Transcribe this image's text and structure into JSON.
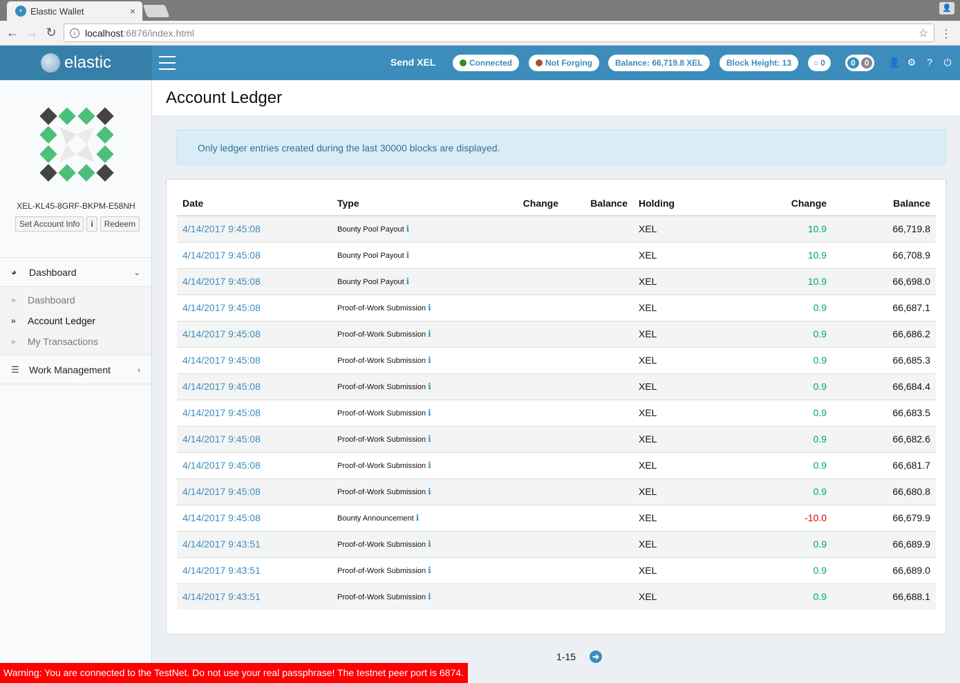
{
  "browser": {
    "tab_title": "Elastic Wallet",
    "tab_close": "×",
    "url_host": "localhost",
    "url_path": ":6876/index.html"
  },
  "header": {
    "logo_text": "elastic",
    "send_label": "Send XEL",
    "connected_label": "Connected",
    "forging_label": "Not Forging",
    "balance_label": "Balance: 66,719.8 XEL",
    "block_height_label": "Block Height: 13",
    "pending_count": "0",
    "msg_count_a": "0",
    "msg_count_b": "0",
    "colors": {
      "bar": "#3c8dbc",
      "logo_bg": "#367fa9",
      "connected_dot": "#00a65a",
      "forging_dot": "#a0522d"
    }
  },
  "sidebar": {
    "account_id": "XEL-KL45-8GRF-BKPM-E58NH",
    "set_account_info": "Set Account Info",
    "info_btn": "i",
    "redeem": "Redeem",
    "menu": {
      "dashboard_group": "Dashboard",
      "items": [
        "Dashboard",
        "Account Ledger",
        "My Transactions"
      ],
      "active_index": 1,
      "work_group": "Work Management"
    }
  },
  "main": {
    "title": "Account Ledger",
    "alert": "Only ledger entries created during the last 30000 blocks are displayed.",
    "columns": [
      "Date",
      "Type",
      "Change",
      "Balance",
      "Holding",
      "Change",
      "Balance"
    ],
    "rows": [
      {
        "date": "4/14/2017 9:45:08",
        "type": "Bounty Pool Payout",
        "holding": "XEL",
        "change": "10.9",
        "balance": "66,719.8",
        "sign": "pos"
      },
      {
        "date": "4/14/2017 9:45:08",
        "type": "Bounty Pool Payout",
        "holding": "XEL",
        "change": "10.9",
        "balance": "66,708.9",
        "sign": "pos"
      },
      {
        "date": "4/14/2017 9:45:08",
        "type": "Bounty Pool Payout",
        "holding": "XEL",
        "change": "10.9",
        "balance": "66,698.0",
        "sign": "pos"
      },
      {
        "date": "4/14/2017 9:45:08",
        "type": "Proof-of-Work Submission",
        "holding": "XEL",
        "change": "0.9",
        "balance": "66,687.1",
        "sign": "pos"
      },
      {
        "date": "4/14/2017 9:45:08",
        "type": "Proof-of-Work Submission",
        "holding": "XEL",
        "change": "0.9",
        "balance": "66,686.2",
        "sign": "pos"
      },
      {
        "date": "4/14/2017 9:45:08",
        "type": "Proof-of-Work Submission",
        "holding": "XEL",
        "change": "0.9",
        "balance": "66,685.3",
        "sign": "pos"
      },
      {
        "date": "4/14/2017 9:45:08",
        "type": "Proof-of-Work Submission",
        "holding": "XEL",
        "change": "0.9",
        "balance": "66,684.4",
        "sign": "pos"
      },
      {
        "date": "4/14/2017 9:45:08",
        "type": "Proof-of-Work Submission",
        "holding": "XEL",
        "change": "0.9",
        "balance": "66,683.5",
        "sign": "pos"
      },
      {
        "date": "4/14/2017 9:45:08",
        "type": "Proof-of-Work Submission",
        "holding": "XEL",
        "change": "0.9",
        "balance": "66,682.6",
        "sign": "pos"
      },
      {
        "date": "4/14/2017 9:45:08",
        "type": "Proof-of-Work Submission",
        "holding": "XEL",
        "change": "0.9",
        "balance": "66,681.7",
        "sign": "pos"
      },
      {
        "date": "4/14/2017 9:45:08",
        "type": "Proof-of-Work Submission",
        "holding": "XEL",
        "change": "0.9",
        "balance": "66,680.8",
        "sign": "pos"
      },
      {
        "date": "4/14/2017 9:45:08",
        "type": "Bounty Announcement",
        "holding": "XEL",
        "change": "-10.0",
        "balance": "66,679.9",
        "sign": "neg"
      },
      {
        "date": "4/14/2017 9:43:51",
        "type": "Proof-of-Work Submission",
        "holding": "XEL",
        "change": "0.9",
        "balance": "66,689.9",
        "sign": "pos"
      },
      {
        "date": "4/14/2017 9:43:51",
        "type": "Proof-of-Work Submission",
        "holding": "XEL",
        "change": "0.9",
        "balance": "66,689.0",
        "sign": "pos"
      },
      {
        "date": "4/14/2017 9:43:51",
        "type": "Proof-of-Work Submission",
        "holding": "XEL",
        "change": "0.9",
        "balance": "66,688.1",
        "sign": "pos"
      }
    ],
    "pager": "1-15"
  },
  "warning": "Warning: You are connected to the TestNet. Do not use your real passphrase! The testnet peer port is 6874."
}
